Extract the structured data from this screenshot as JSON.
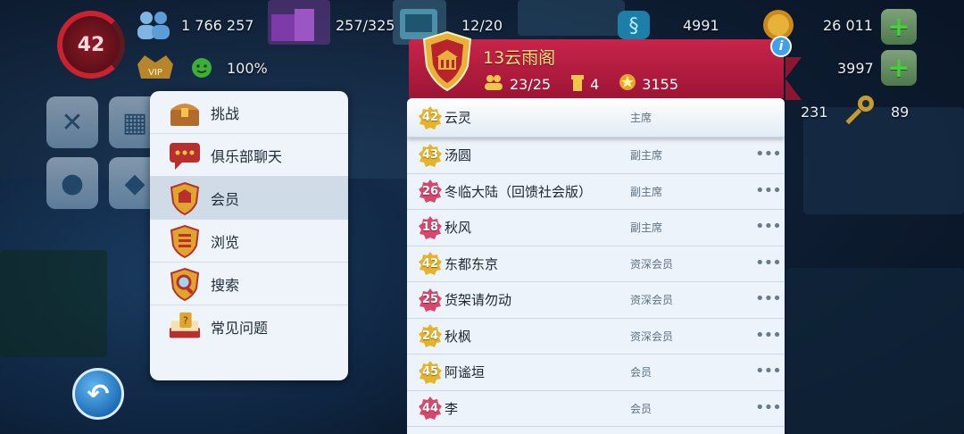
{
  "hud": {
    "level": "42",
    "population": "1 766 257",
    "storage": "257/325",
    "workers": "12/20",
    "happiness": "100%",
    "simoleons": "4991",
    "gold_coins": "26 011",
    "simcash": "3997",
    "keys": "89",
    "extra": "231",
    "vip_label": "VIP"
  },
  "menu": {
    "items": [
      {
        "label": "挑战",
        "icon": "treasure-chest-icon"
      },
      {
        "label": "俱乐部聊天",
        "icon": "chat-bubble-icon"
      },
      {
        "label": "会员",
        "icon": "club-shield-icon"
      },
      {
        "label": "浏览",
        "icon": "browse-shield-icon"
      },
      {
        "label": "搜索",
        "icon": "magnifier-icon"
      },
      {
        "label": "常见问题",
        "icon": "help-book-icon"
      }
    ],
    "active_index": 2
  },
  "club": {
    "name": "13云雨阁",
    "members": "23/25",
    "towers": "4",
    "points": "3155"
  },
  "members": [
    {
      "level": "42",
      "name": "云灵",
      "role": "主席",
      "badge": "gold",
      "more": ""
    },
    {
      "level": "43",
      "name": "汤圆",
      "role": "副主席",
      "badge": "gold",
      "more": "•••"
    },
    {
      "level": "26",
      "name": "冬临大陆（回馈社会版）",
      "role": "副主席",
      "badge": "pink",
      "more": "•••"
    },
    {
      "level": "18",
      "name": "秋风",
      "role": "副主席",
      "badge": "pink",
      "more": "•••"
    },
    {
      "level": "42",
      "name": "东都东京",
      "role": "资深会员",
      "badge": "gold",
      "more": "•••"
    },
    {
      "level": "25",
      "name": "货架请勿动",
      "role": "资深会员",
      "badge": "pink",
      "more": "•••"
    },
    {
      "level": "24",
      "name": "秋枫",
      "role": "资深会员",
      "badge": "gold",
      "more": "•••"
    },
    {
      "level": "45",
      "name": "阿谧垣",
      "role": "会员",
      "badge": "gold",
      "more": "•••"
    },
    {
      "level": "44",
      "name": "李",
      "role": "会员",
      "badge": "pink",
      "more": "•••"
    }
  ],
  "colors": {
    "banner": "#c8244a",
    "gold_badge": "#e6b42a",
    "pink_badge": "#d9476b"
  }
}
